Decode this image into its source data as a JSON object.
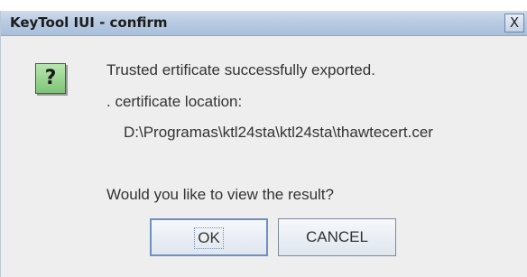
{
  "window": {
    "title": "KeyTool IUI - confirm",
    "close_label": "X"
  },
  "dialog": {
    "icon_glyph": "?",
    "icon_name": "question-icon",
    "line1": "Trusted ertificate successfully exported.",
    "line2": ". certificate location:",
    "path": "D:\\Programas\\ktl24sta\\ktl24sta\\thawtecert.cer",
    "question": "Would you like to view the result?"
  },
  "buttons": {
    "ok_label": "OK",
    "cancel_label": "CANCEL"
  }
}
